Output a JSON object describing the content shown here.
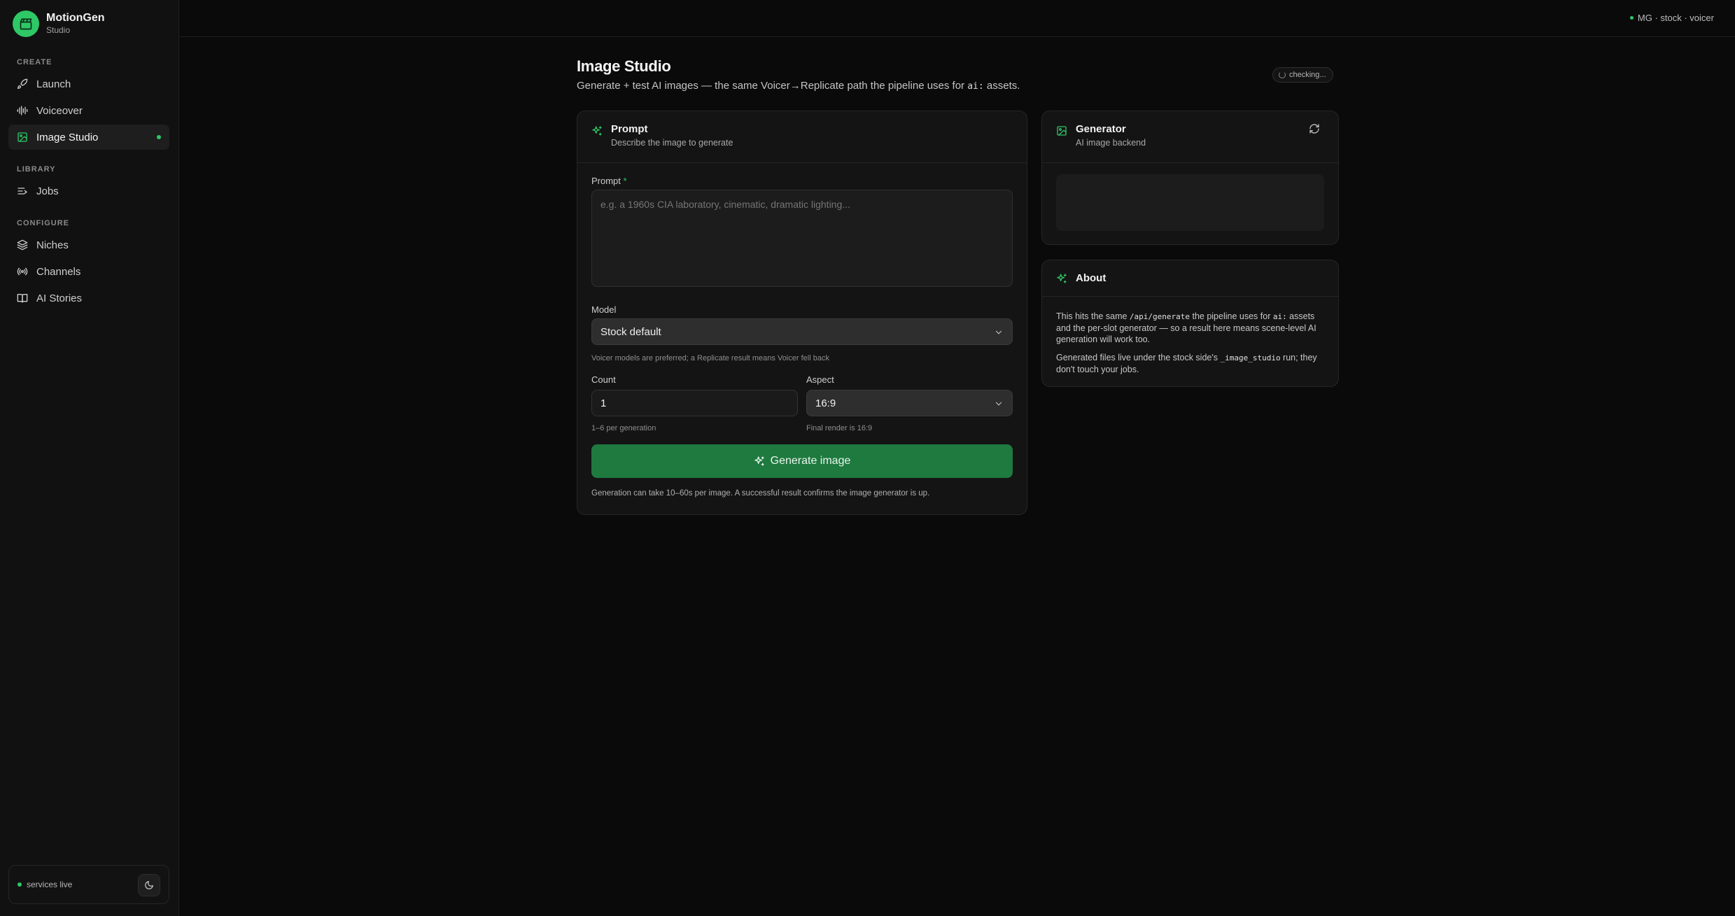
{
  "brand": {
    "name": "MotionGen",
    "subtitle": "Studio"
  },
  "sidebar": {
    "sections": {
      "create": "CREATE",
      "library": "LIBRARY",
      "configure": "CONFIGURE"
    },
    "items": [
      {
        "label": "Launch",
        "icon": "rocket-icon"
      },
      {
        "label": "Voiceover",
        "icon": "waveform-icon"
      },
      {
        "label": "Image Studio",
        "icon": "image-icon",
        "active": true
      },
      {
        "label": "Jobs",
        "icon": "list-icon"
      },
      {
        "label": "Niches",
        "icon": "layers-icon"
      },
      {
        "label": "Channels",
        "icon": "broadcast-icon"
      },
      {
        "label": "AI Stories",
        "icon": "book-icon"
      }
    ],
    "status": "services live"
  },
  "topbar": {
    "status": "MG · stock · voicer"
  },
  "page": {
    "title": "Image Studio",
    "subtitle_pre": "Generate + test AI images — the same Voicer→Replicate path the pipeline uses for ",
    "subtitle_code": "ai:",
    "subtitle_post": " assets.",
    "checking": "checking..."
  },
  "prompt_card": {
    "title": "Prompt",
    "subtitle": "Describe the image to generate",
    "prompt_label": "Prompt",
    "prompt_required": "*",
    "prompt_placeholder": "e.g. a 1960s CIA laboratory, cinematic, dramatic lighting...",
    "model_label": "Model",
    "model_value": "Stock default",
    "model_hint": "Voicer models are preferred; a Replicate result means Voicer fell back",
    "count_label": "Count",
    "count_value": "1",
    "count_hint": "1–6 per generation",
    "aspect_label": "Aspect",
    "aspect_value": "16:9",
    "aspect_hint": "Final render is 16:9",
    "generate_label": "Generate image",
    "footnote": "Generation can take 10–60s per image. A successful result confirms the image generator is up."
  },
  "generator_card": {
    "title": "Generator",
    "subtitle": "AI image backend"
  },
  "about_card": {
    "title": "About",
    "p1_a": "This hits the same ",
    "p1_code1": "/api/generate",
    "p1_b": " the pipeline uses for ",
    "p1_code2": "ai:",
    "p1_c": " assets and the per-slot generator — so a result here means scene-level AI generation will work too.",
    "p2_a": "Generated files live under the stock side's ",
    "p2_code": "_image_studio",
    "p2_b": " run; they don't touch your jobs."
  },
  "colors": {
    "accent": "#2ec866",
    "button": "#1e7a3f",
    "background": "#0a0a0a"
  }
}
